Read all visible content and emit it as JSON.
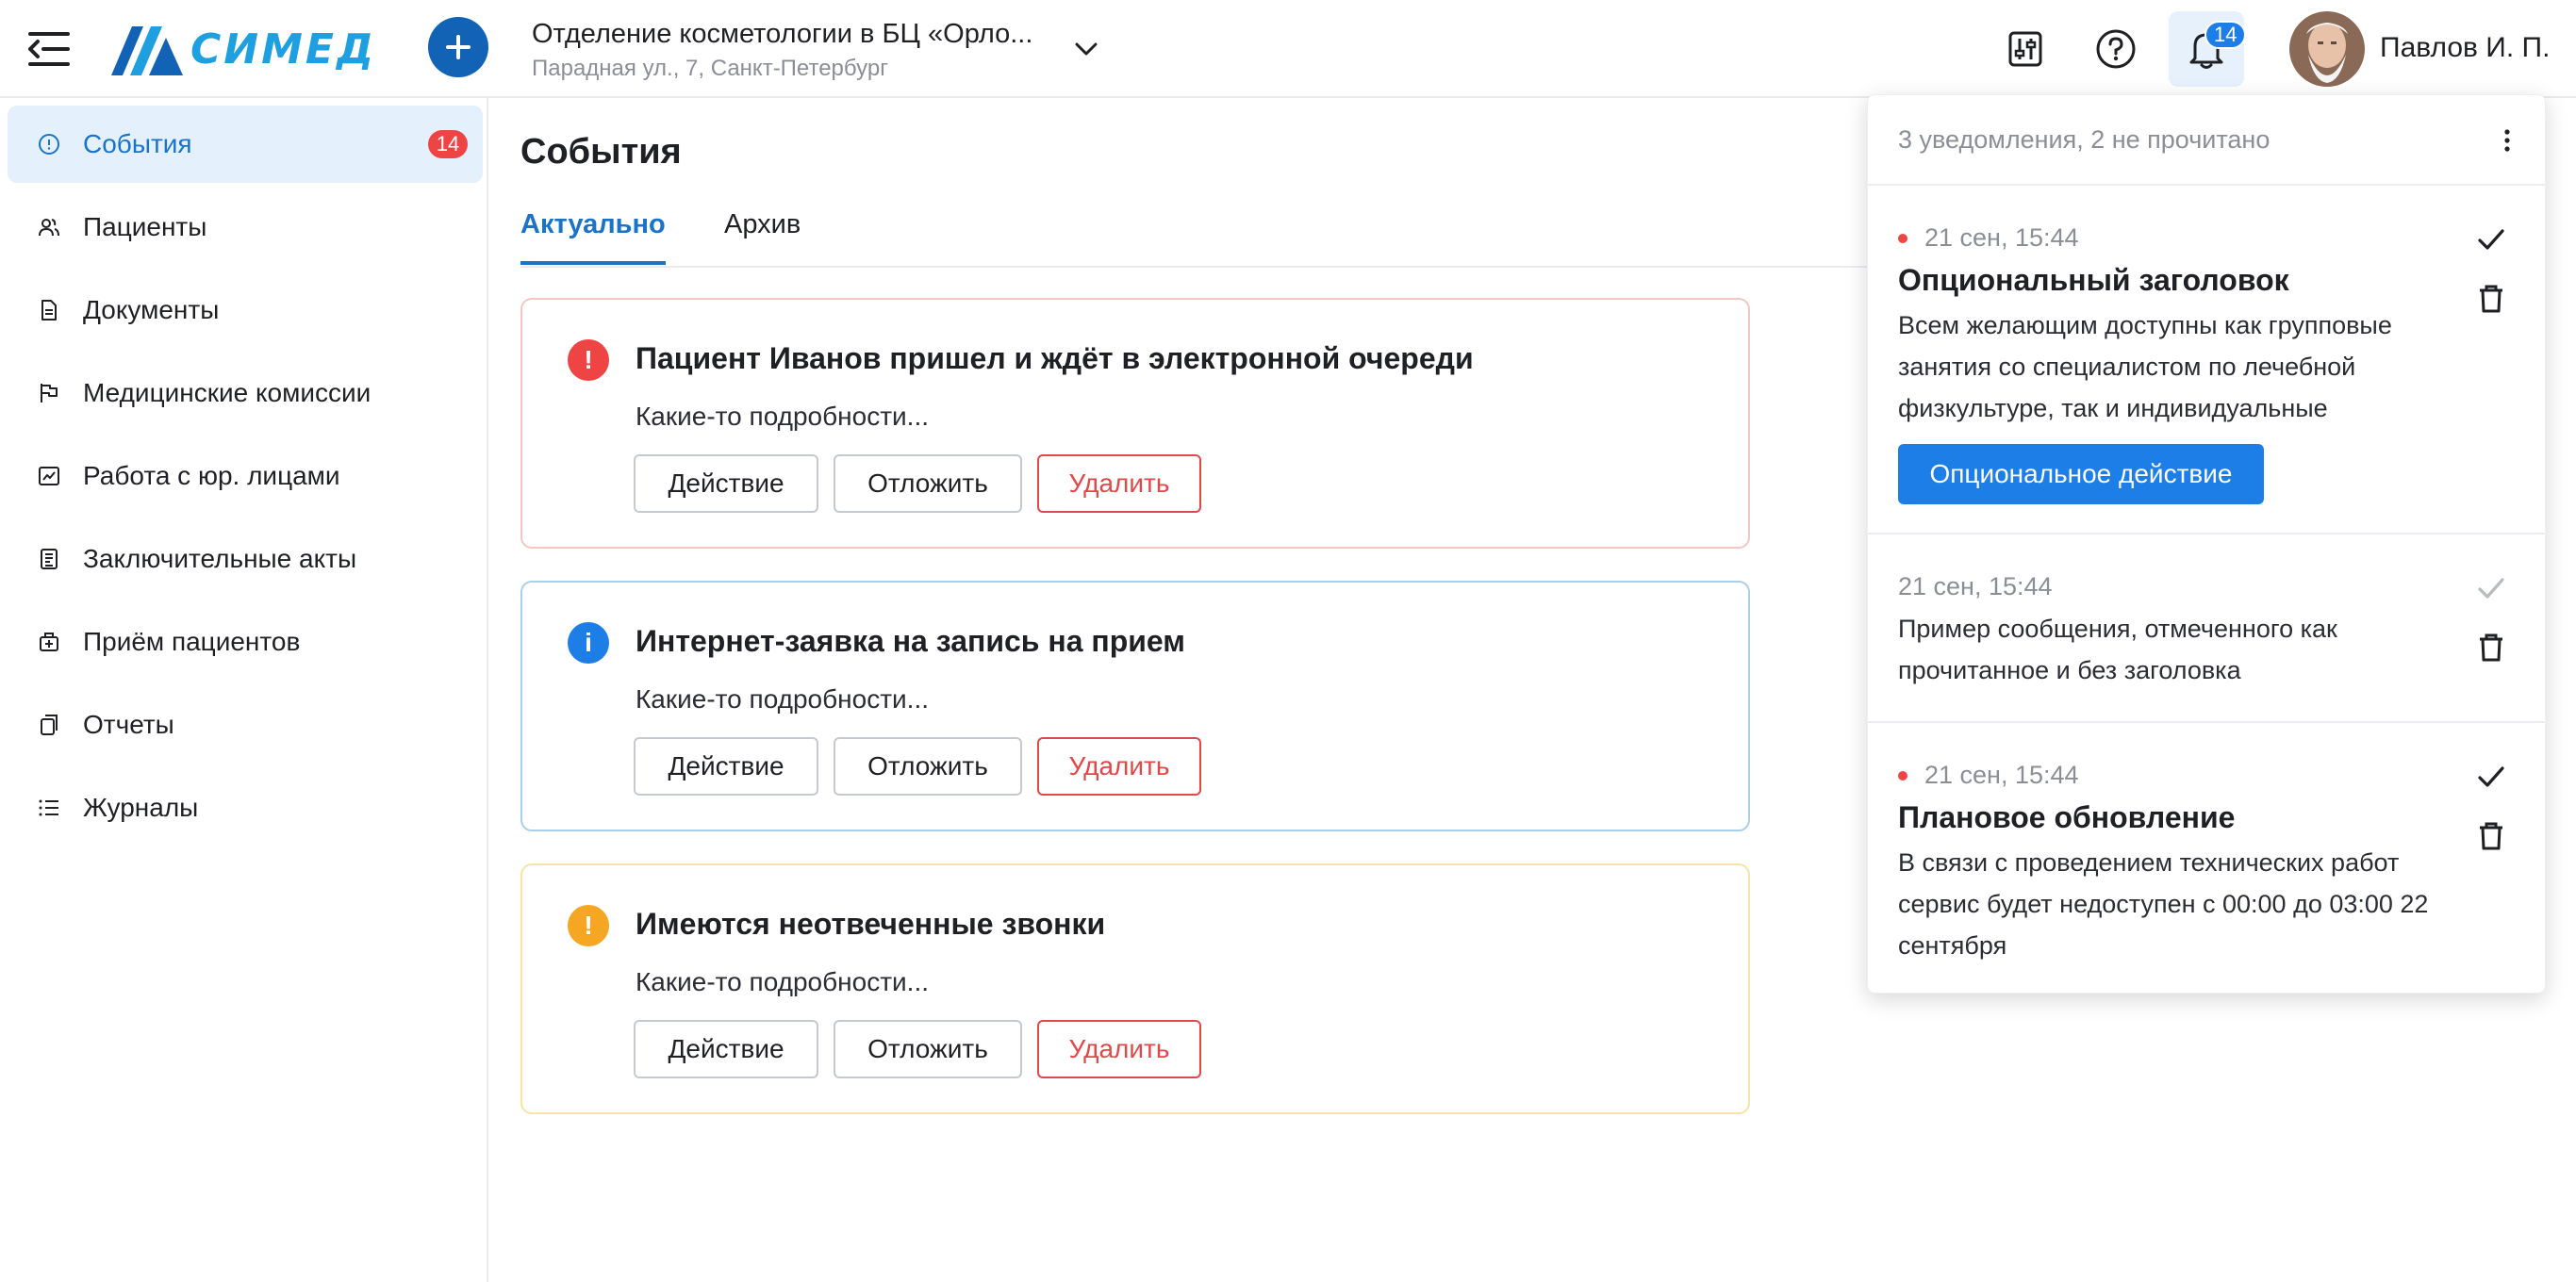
{
  "header": {
    "logo_text": "СИМЕД",
    "org_name": "Отделение косметологии в БЦ «Орло...",
    "org_address": "Парадная ул., 7, Санкт-Петербург",
    "notifications_badge": "14",
    "user_name": "Павлов И. П."
  },
  "sidebar": {
    "items": [
      {
        "label": "События",
        "icon": "alert-circle-icon",
        "badge": "14"
      },
      {
        "label": "Пациенты",
        "icon": "patients-icon"
      },
      {
        "label": "Документы",
        "icon": "document-icon"
      },
      {
        "label": "Медицинские комиссии",
        "icon": "flag-icon"
      },
      {
        "label": "Работа с юр. лицами",
        "icon": "chart-icon"
      },
      {
        "label": "Заключительные акты",
        "icon": "act-icon"
      },
      {
        "label": "Приём пациентов",
        "icon": "medical-bag-icon"
      },
      {
        "label": "Отчеты",
        "icon": "reports-icon"
      },
      {
        "label": "Журналы",
        "icon": "list-icon"
      }
    ]
  },
  "main": {
    "title": "События",
    "tabs": [
      {
        "label": "Актуально"
      },
      {
        "label": "Архив"
      }
    ],
    "cards": [
      {
        "title": "Пациент Иванов пришел и ждёт в электронной очереди",
        "details": "Какие-то подробности...",
        "severity": "error",
        "icon_glyph": "!"
      },
      {
        "title": "Интернет-заявка на запись на прием",
        "details": "Какие-то подробности...",
        "severity": "info",
        "icon_glyph": "i"
      },
      {
        "title": "Имеются неотвеченные звонки",
        "details": "Какие-то подробности...",
        "severity": "warning",
        "icon_glyph": "!"
      }
    ],
    "buttons": {
      "action": "Действие",
      "postpone": "Отложить",
      "delete": "Удалить"
    }
  },
  "notifications": {
    "summary": "3 уведомления, 2 не прочитано",
    "items": [
      {
        "time": "21 сен, 15:44",
        "title": "Опциональный заголовок",
        "text": "Всем желающим доступны как групповые занятия со специалистом по лечебной физкультуре, так и индивидуальные",
        "action": "Опциональное действие",
        "unread": true
      },
      {
        "time": "21 сен, 15:44",
        "text": "Пример сообщения, отмеченного как прочитанное и без заголовка",
        "unread": false
      },
      {
        "time": "21 сен, 15:44",
        "title": "Плановое обновление",
        "text": "В связи с проведением технических работ сервис будет недоступен с 00:00 до 03:00 22 сентября",
        "unread": true
      }
    ]
  },
  "colors": {
    "primary": "#1e7ee8",
    "brand_dark": "#1263b5",
    "error": "#ef4444",
    "warning": "#f5a623",
    "active_bg": "#e4f1fc"
  }
}
